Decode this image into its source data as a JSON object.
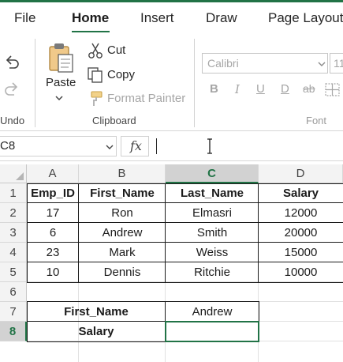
{
  "ribbon_tabs": [
    "File",
    "Home",
    "Insert",
    "Draw",
    "Page Layout"
  ],
  "clipboard": {
    "undo_label": "Undo",
    "paste_label": "Paste",
    "cut_label": "Cut",
    "copy_label": "Copy",
    "format_painter_label": "Format Painter",
    "group_label": "Clipboard"
  },
  "font_group": {
    "font_name": "Calibri",
    "font_size": "11",
    "group_label": "Font",
    "bold": "B",
    "italic": "I",
    "underline": "U",
    "double_underline": "D",
    "strikethrough": "ab"
  },
  "formula_bar": {
    "name_box": "C8",
    "fx_label": "fx",
    "formula": ""
  },
  "sheet": {
    "columns": [
      "A",
      "B",
      "C",
      "D"
    ],
    "selected_column": "C",
    "rows": [
      "1",
      "2",
      "3",
      "4",
      "5",
      "6",
      "7",
      "8"
    ],
    "selected_row": "8",
    "table_headers": [
      "Emp_ID",
      "First_Name",
      "Last_Name",
      "Salary"
    ],
    "table_rows": [
      [
        "17",
        "Ron",
        "Elmasri",
        "12000"
      ],
      [
        "6",
        "Andrew",
        "Smith",
        "20000"
      ],
      [
        "23",
        "Mark",
        "Weiss",
        "15000"
      ],
      [
        "10",
        "Dennis",
        "Ritchie",
        "10000"
      ]
    ],
    "lookup_label_1": "First_Name",
    "lookup_value_1": "Andrew",
    "lookup_label_2": "Salary",
    "lookup_value_2": ""
  }
}
